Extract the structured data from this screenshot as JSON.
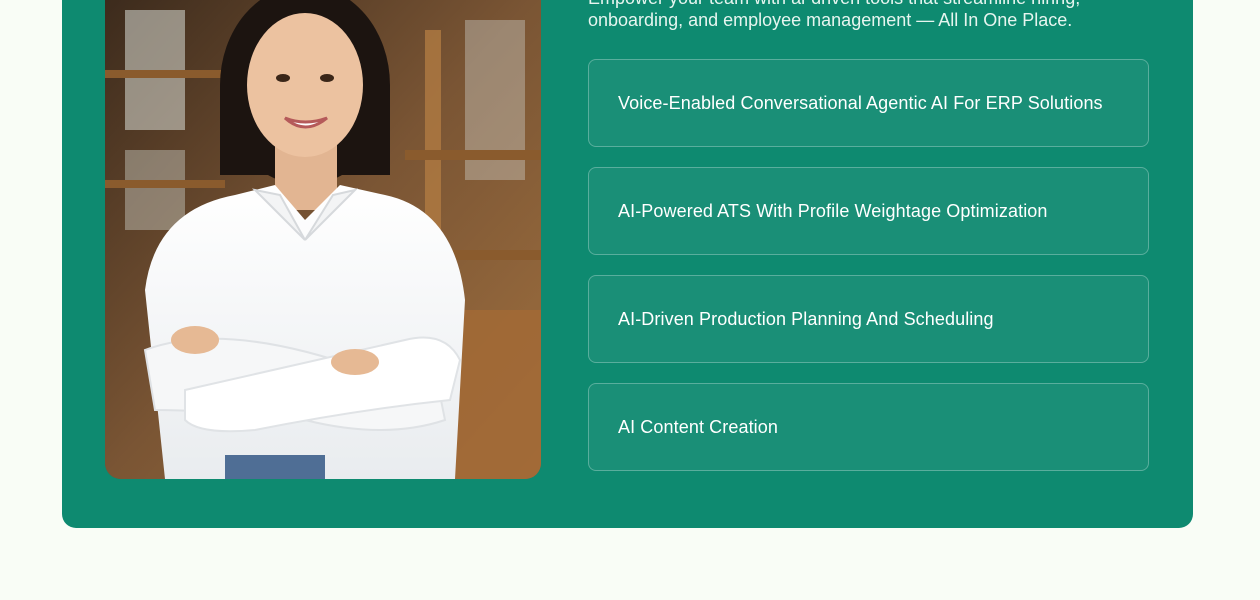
{
  "hero": {
    "intro_text": "Empower your team with ai-driven tools that streamline hiring, onboarding, and employee management — All In One Place.",
    "features": [
      {
        "label": "Voice-Enabled Conversational Agentic AI For ERP Solutions"
      },
      {
        "label": "AI-Powered ATS With Profile Weightage Optimization"
      },
      {
        "label": "AI-Driven Production Planning And Scheduling"
      },
      {
        "label": "AI Content Creation"
      }
    ]
  },
  "colors": {
    "panel": "#0e8a70",
    "page_background": "#f9fdf6",
    "text": "#ffffff"
  }
}
